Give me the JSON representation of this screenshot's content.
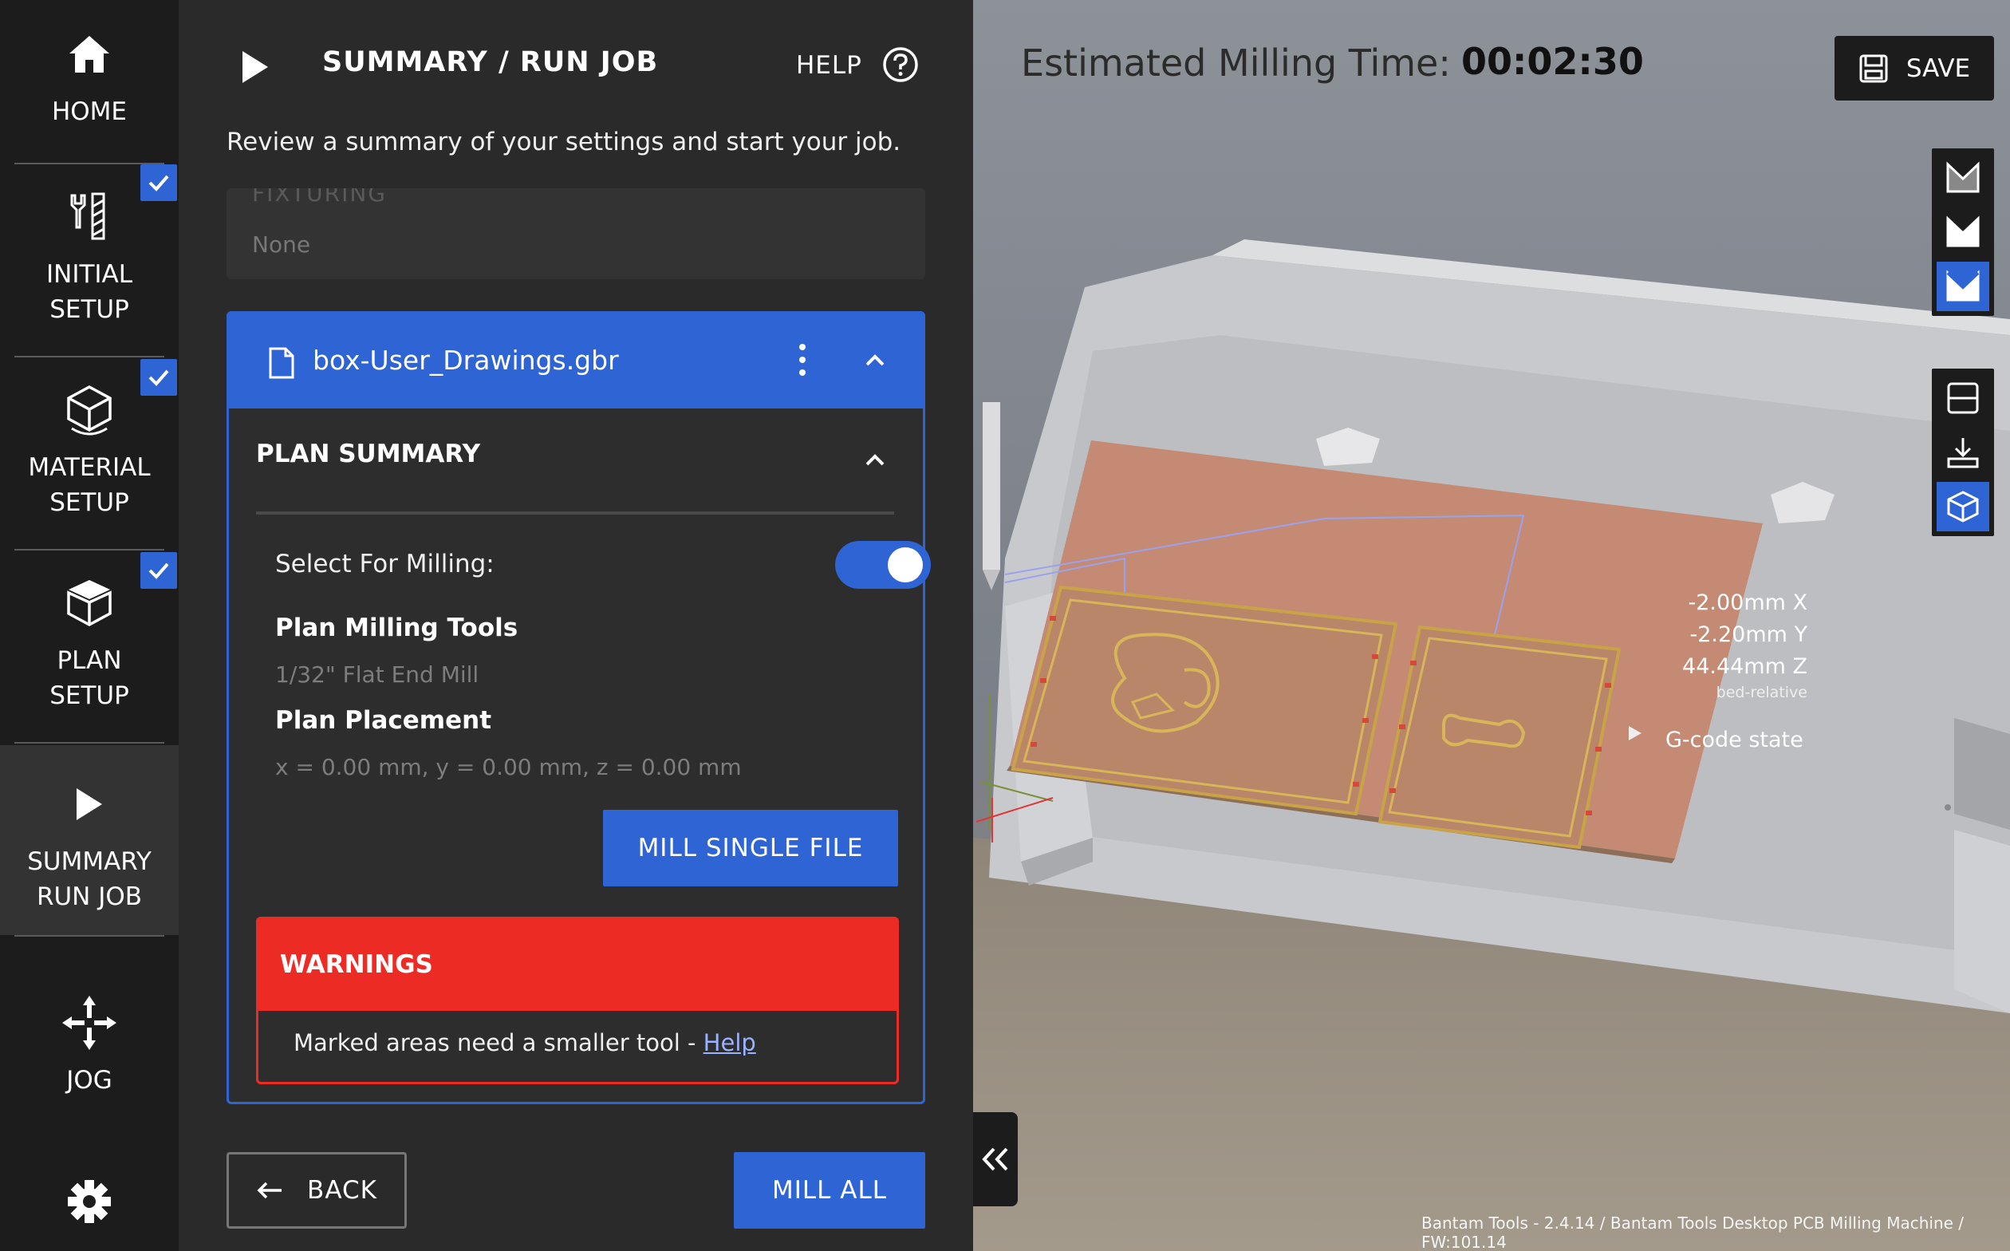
{
  "nav": {
    "items": [
      {
        "label": "HOME"
      },
      {
        "label": "INITIAL\nSETUP"
      },
      {
        "label": "MATERIAL\nSETUP"
      },
      {
        "label": "PLAN\nSETUP"
      },
      {
        "label": "SUMMARY\nRUN JOB"
      },
      {
        "label": "JOG"
      }
    ]
  },
  "header": {
    "title": "SUMMARY / RUN JOB",
    "help_label": "HELP",
    "subtitle": "Review a summary of your settings and start your job."
  },
  "fixturing": {
    "label": "FIXTURING",
    "value": "None"
  },
  "file_card": {
    "file_name": "box-User_Drawings.gbr",
    "plan_summary_title": "PLAN SUMMARY",
    "select_for_milling_label": "Select For Milling:",
    "select_for_milling": true,
    "plan_tools_title": "Plan Milling Tools",
    "plan_tools_value": "1/32\" Flat End Mill",
    "plan_placement_title": "Plan Placement",
    "plan_placement_value": "x = 0.00 mm, y = 0.00 mm, z = 0.00 mm",
    "mill_single_label": "MILL SINGLE FILE",
    "warnings_title": "WARNINGS",
    "warning_text": "Marked areas need a smaller tool - ",
    "warning_link": "Help"
  },
  "footer_buttons": {
    "back_label": "BACK",
    "mill_all_label": "MILL ALL"
  },
  "view": {
    "estimate_label": "Estimated Milling Time:",
    "estimate_value": "00:02:30",
    "save_label": "SAVE",
    "coord_x": "-2.00mm X",
    "coord_y": "-2.20mm Y",
    "coord_z": "44.44mm Z",
    "coord_ref": "bed-relative",
    "gcode_label": "G-code state",
    "footer_info": "Bantam Tools - 2.4.14 / Bantam Tools Desktop PCB Milling Machine / FW:101.14"
  },
  "colors": {
    "accent": "#2f64d4",
    "warning": "#ec2b24",
    "panel": "#2a2a2a",
    "nav": "#1c1c1c",
    "board": "#c58a74"
  }
}
